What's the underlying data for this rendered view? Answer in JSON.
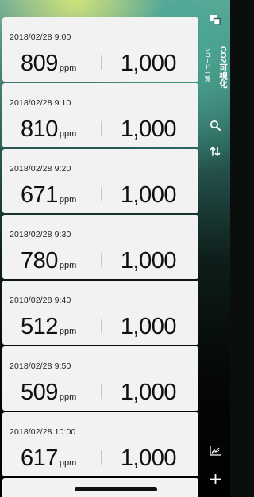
{
  "sidebar": {
    "title": "CO2可視化",
    "subtitle": "レコード一覧",
    "icons": [
      "switch-view-icon",
      "search-icon",
      "sort-icon",
      "chart-icon",
      "add-icon"
    ]
  },
  "records": [
    {
      "timestamp": "2018/02/28 9:00",
      "value": "809",
      "unit": "ppm",
      "limit": "1,000"
    },
    {
      "timestamp": "2018/02/28 9:10",
      "value": "810",
      "unit": "ppm",
      "limit": "1,000"
    },
    {
      "timestamp": "2018/02/28 9:20",
      "value": "671",
      "unit": "ppm",
      "limit": "1,000"
    },
    {
      "timestamp": "2018/02/28 9:30",
      "value": "780",
      "unit": "ppm",
      "limit": "1,000"
    },
    {
      "timestamp": "2018/02/28 9:40",
      "value": "512",
      "unit": "ppm",
      "limit": "1,000"
    },
    {
      "timestamp": "2018/02/28 9:50",
      "value": "509",
      "unit": "ppm",
      "limit": "1,000"
    },
    {
      "timestamp": "2018/02/28 10:00",
      "value": "617",
      "unit": "ppm",
      "limit": "1,000"
    }
  ]
}
